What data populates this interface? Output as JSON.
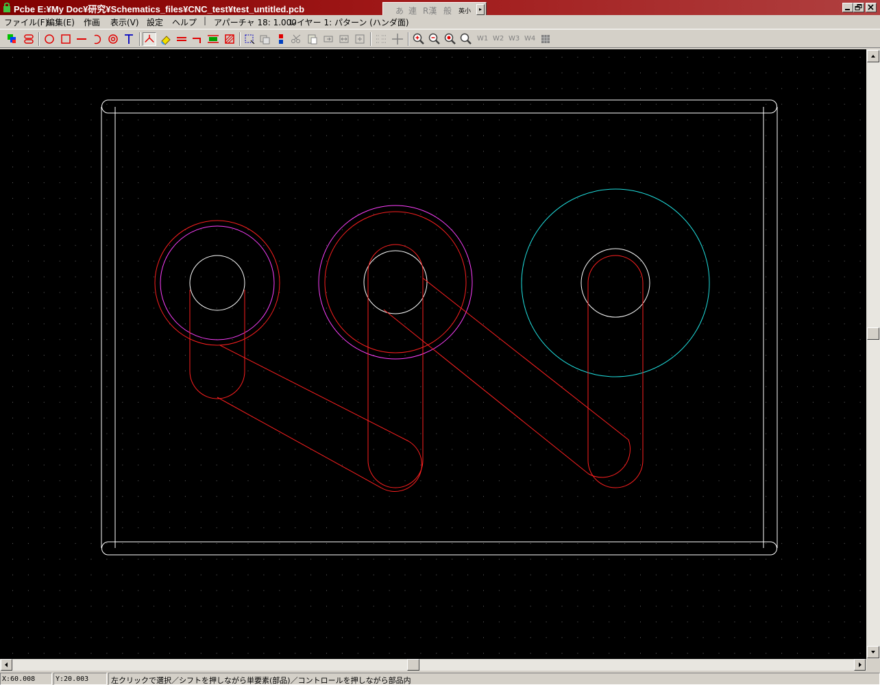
{
  "window": {
    "title": "Pcbe  E:¥My Doc¥研究¥Schematics_files¥CNC_test¥test_untitled.pcb"
  },
  "ime": {
    "items": [
      "あ",
      "連",
      "R漢",
      "般"
    ],
    "mode": "英小",
    "arrow": "▸"
  },
  "menu": {
    "items": [
      "ファイル(F)",
      "編集(E)",
      "作画",
      "表示(V)",
      "設定",
      "ヘルプ"
    ],
    "aperture": "アパーチャ 18: 1.000",
    "layer": "レイヤー 1: パターン (ハンダ面)"
  },
  "toolbar": {
    "icons": [
      "layer-color-icon",
      "via-icon",
      "circle-tool-icon",
      "rectangle-tool-icon",
      "line-tool-icon",
      "arc-tool-icon",
      "pad-tool-icon",
      "text-tool-icon",
      "pattern-tool-icon",
      "eraser-tool-icon",
      "parallel-line-icon",
      "jumper-icon",
      "component-icon",
      "hatch-icon",
      "select-icon",
      "copy-icon",
      "move-icon",
      "cut-icon",
      "paste-icon",
      "rotate-icon",
      "mirror-icon",
      "resize-icon",
      "grid-icon",
      "crosshair-icon",
      "zoom-in-icon",
      "zoom-out-icon",
      "zoom-fit-icon",
      "zoom-window-icon"
    ],
    "view_labels": [
      "W1",
      "W2",
      "W3",
      "W4"
    ]
  },
  "colors": {
    "outline": "#ffffff",
    "trace": "#ff2020",
    "magenta": "#ff40ff",
    "cyan": "#20e0e0",
    "grid_dot": "#6a6a6a",
    "canvas_bg": "#000000"
  },
  "status": {
    "x": "X:60.008",
    "y": "Y:20.003",
    "message": "左クリックで選択／シフトを押しながら単要素(部品)／コントロールを押しながら部品内"
  }
}
